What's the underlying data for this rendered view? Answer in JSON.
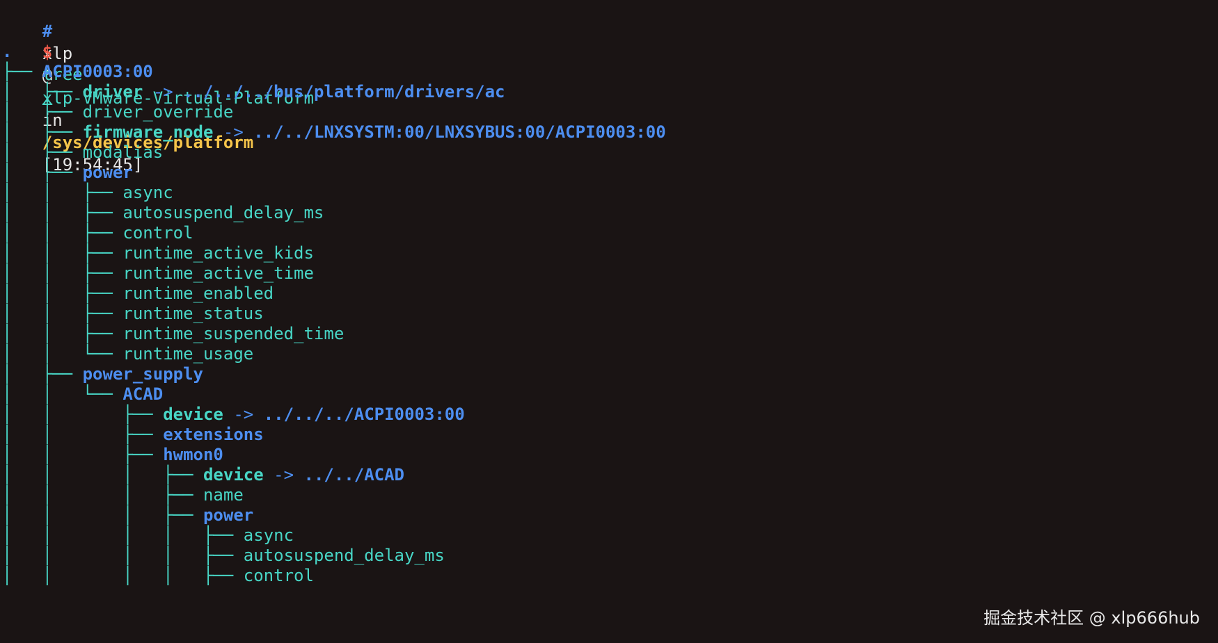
{
  "prompt": {
    "hash": "#",
    "user": "xlp",
    "at": "@",
    "host": "xlp-VMware-Virtual-Platform",
    "in": "in",
    "cwd": "/sys/devices/platform",
    "time": "[19:54:45]",
    "dollar": "$",
    "command": "tree",
    "argument": "."
  },
  "tree": [
    {
      "prefix": "",
      "name": ".",
      "style": "dir"
    },
    {
      "prefix": "├── ",
      "name": "ACPI0003:00",
      "style": "dir"
    },
    {
      "prefix": "│   ├── ",
      "name": "driver",
      "style": "link",
      "arrow": "->",
      "target": "../../../bus/platform/drivers/ac"
    },
    {
      "prefix": "│   ├── ",
      "name": "driver_override",
      "style": "file"
    },
    {
      "prefix": "│   ├── ",
      "name": "firmware_node",
      "style": "link",
      "arrow": "->",
      "target": "../../LNXSYSTM:00/LNXSYBUS:00/ACPI0003:00"
    },
    {
      "prefix": "│   ├── ",
      "name": "modalias",
      "style": "file"
    },
    {
      "prefix": "│   ├── ",
      "name": "power",
      "style": "dir"
    },
    {
      "prefix": "│   │   ├── ",
      "name": "async",
      "style": "file"
    },
    {
      "prefix": "│   │   ├── ",
      "name": "autosuspend_delay_ms",
      "style": "file"
    },
    {
      "prefix": "│   │   ├── ",
      "name": "control",
      "style": "file"
    },
    {
      "prefix": "│   │   ├── ",
      "name": "runtime_active_kids",
      "style": "file"
    },
    {
      "prefix": "│   │   ├── ",
      "name": "runtime_active_time",
      "style": "file"
    },
    {
      "prefix": "│   │   ├── ",
      "name": "runtime_enabled",
      "style": "file"
    },
    {
      "prefix": "│   │   ├── ",
      "name": "runtime_status",
      "style": "file"
    },
    {
      "prefix": "│   │   ├── ",
      "name": "runtime_suspended_time",
      "style": "file"
    },
    {
      "prefix": "│   │   └── ",
      "name": "runtime_usage",
      "style": "file"
    },
    {
      "prefix": "│   ├── ",
      "name": "power_supply",
      "style": "dir"
    },
    {
      "prefix": "│   │   └── ",
      "name": "ACAD",
      "style": "dir"
    },
    {
      "prefix": "│   │       ├── ",
      "name": "device",
      "style": "link",
      "arrow": "->",
      "target": "../../../ACPI0003:00"
    },
    {
      "prefix": "│   │       ├── ",
      "name": "extensions",
      "style": "dir"
    },
    {
      "prefix": "│   │       ├── ",
      "name": "hwmon0",
      "style": "dir"
    },
    {
      "prefix": "│   │       │   ├── ",
      "name": "device",
      "style": "link",
      "arrow": "->",
      "target": "../../ACAD"
    },
    {
      "prefix": "│   │       │   ├── ",
      "name": "name",
      "style": "file"
    },
    {
      "prefix": "│   │       │   ├── ",
      "name": "power",
      "style": "dir"
    },
    {
      "prefix": "│   │       │   │   ├── ",
      "name": "async",
      "style": "file"
    },
    {
      "prefix": "│   │       │   │   ├── ",
      "name": "autosuspend_delay_ms",
      "style": "file"
    },
    {
      "prefix": "│   │       │   │   ├── ",
      "name": "control",
      "style": "file"
    }
  ],
  "watermark": "掘金技术社区 @ xlp666hub",
  "colors": {
    "background": "#1a1414",
    "tree_lines": "#48d6c6",
    "directory": "#4d8ef0",
    "path": "#f5c44a",
    "dollar": "#f05a4a"
  }
}
